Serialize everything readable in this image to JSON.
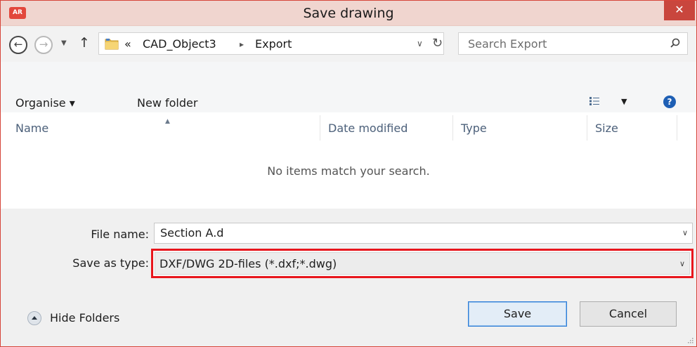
{
  "window": {
    "title": "Save drawing",
    "app_icon_text": "AR",
    "close_glyph": "✕"
  },
  "nav": {
    "back_icon": "back-arrow-icon",
    "forward_icon": "forward-arrow-icon",
    "up_icon": "up-arrow-icon",
    "breadcrumb": {
      "prefix": "«",
      "items": [
        "CAD_Object3",
        "Export"
      ],
      "separator": "▸"
    },
    "search_placeholder": "Search Export"
  },
  "toolbar": {
    "organise_label": "Organise ▾",
    "new_folder_label": "New folder"
  },
  "filelist": {
    "columns": [
      "Name",
      "Date modified",
      "Type",
      "Size"
    ],
    "empty_message": "No items match your search."
  },
  "form": {
    "file_name_label": "File name:",
    "file_name_value": "Section A.d",
    "save_type_label": "Save as type:",
    "save_type_value": "DXF/DWG 2D-files (*.dxf;*.dwg)"
  },
  "footer": {
    "hide_folders_label": "Hide Folders",
    "save_label": "Save",
    "cancel_label": "Cancel"
  },
  "colors": {
    "titlebar_bg": "#f0d5cf",
    "close_button_bg": "#c9463d",
    "highlight_border": "#e8161d",
    "save_button_border": "#2d7dd8",
    "column_header_text": "#4c607a"
  }
}
